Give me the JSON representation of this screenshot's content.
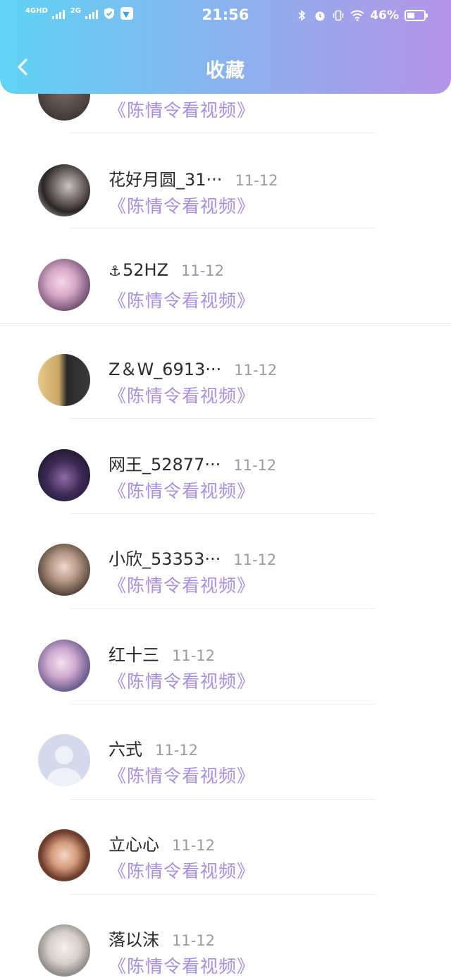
{
  "status_bar": {
    "network1": "4GHD",
    "network2": "2G",
    "time": "21:56",
    "battery_text": "46%",
    "battery_level": 0.46,
    "icons": [
      "shield-icon",
      "app-icon",
      "bluetooth-icon",
      "alarm-icon",
      "vibrate-icon",
      "wifi-icon",
      "battery-icon"
    ]
  },
  "nav": {
    "title": "收藏",
    "back_icon": "chevron-left-icon"
  },
  "colors": {
    "header_gradient_start": "#5fd3f3",
    "header_gradient_end": "#b494e6",
    "favorite_text": "#a98ee6",
    "name_text": "#2b2b2b",
    "date_text": "#9b9b9b"
  },
  "items": [
    {
      "name": "",
      "date": "",
      "favorite": "《陈情令看视频》"
    },
    {
      "name": "花好月圆_31···",
      "date": "11-12",
      "favorite": "《陈情令看视频》"
    },
    {
      "name": "52HZ",
      "date": "11-12",
      "favorite": "《陈情令看视频》"
    },
    {
      "name": "Z＆W_6913···",
      "date": "11-12",
      "favorite": "《陈情令看视频》"
    },
    {
      "name": "网王_52877···",
      "date": "11-12",
      "favorite": "《陈情令看视频》"
    },
    {
      "name": "小欣_53353···",
      "date": "11-12",
      "favorite": "《陈情令看视频》"
    },
    {
      "name": "红十三",
      "date": "11-12",
      "favorite": "《陈情令看视频》"
    },
    {
      "name": "六式",
      "date": "11-12",
      "favorite": "《陈情令看视频》"
    },
    {
      "name": "立心心",
      "date": "11-12",
      "favorite": "《陈情令看视频》"
    },
    {
      "name": "落以沫",
      "date": "11-12",
      "favorite": "《陈情令看视频》"
    }
  ]
}
